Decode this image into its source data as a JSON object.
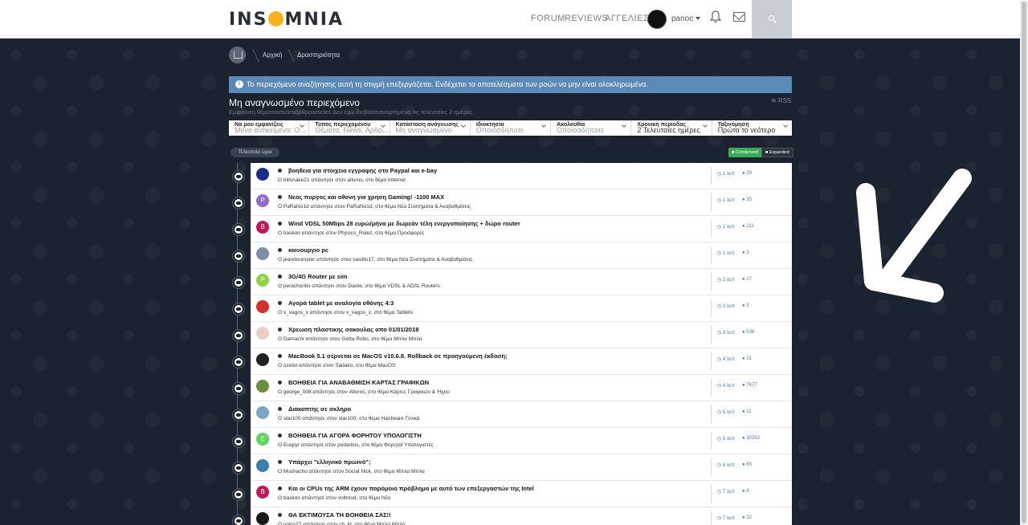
{
  "header": {
    "logo_text": "INSOMNIA",
    "nav": [
      "FORUM",
      "REVIEWS",
      "ΑΓΓΕΛΙΕΣ"
    ],
    "username": "panoc"
  },
  "breadcrumb": [
    "Αρχική",
    "Δραστηριότητα"
  ],
  "info_message": "Το περιεχόμενο αναζήτησης αυτή τη στιγμή επεξεργάζεται. Ενδέχεται τα αποτελέσματα των ροών να μην είναι ολοκληρωμένα.",
  "page_title": "Μη αναγνωσμένο περιεχόμενο",
  "rss_label": "RSS",
  "subtitle": "Εμφάνιση θέματαarticlesάρθραarticles Δεν έχω διαβάσειαναρτημένα τις τελευταίες 2 ημέρες.",
  "filters": [
    {
      "label": "Να μου εμφανίζεις",
      "value": "Μόνο αντικείμενα: Ο..."
    },
    {
      "label": "Τύπος περιεχομένου",
      "value": "Θέματα, News, Άρθρ..."
    },
    {
      "label": "Κατάσταση ανάγνωσης",
      "value": "Μη αναγνωσμένο"
    },
    {
      "label": "Ιδιοκτησία",
      "value": "Οποιοσδήποτε"
    },
    {
      "label": "Ακολουθία",
      "value": "Οποιοσδήποτε"
    },
    {
      "label": "Χρονική περίοδος",
      "value": "2 Τελευταίες ημέρες"
    },
    {
      "label": "Ταξινόμηση",
      "value": "Πρώτα το νεότερο"
    }
  ],
  "time_group": "Τελευταία ώρα",
  "view_toggle": {
    "condensed": "Condensed",
    "expanded": "Expanded"
  },
  "activity": [
    {
      "title": "βοηθεια για στοιχεια εγγραφης στο Paypal και e-bay",
      "meta": "O billsnake21 απάντησε στον alluros, στο θέμα Internet",
      "time": "1 λεπ",
      "replies": "29",
      "avatar": {
        "letter": "",
        "color": "#1b2f8a"
      }
    },
    {
      "title": "Νεος πυργος και οθονη για χρηση Gaming! -1100 MAX",
      "meta": "O PaRaNo1d απάντησε στον PaRaNo1d, στο θέμα Νέα Συστήματα & Αναβαθμίσεις",
      "time": "1 λεπ",
      "replies": "35",
      "avatar": {
        "letter": "P",
        "color": "#8e6bc9"
      }
    },
    {
      "title": "Wind VDSL 50Mbps 28 ευρώ/μήνα με δωρεάν τέλη ενεργοποίησης + δώρο router",
      "meta": "O baskon απάντησε στον Physics_Rulez, στο θέμα Προσφορές",
      "time": "1 λεπ",
      "replies": "211",
      "avatar": {
        "letter": "B",
        "color": "#c2185b"
      }
    },
    {
      "title": "καινουργιο pc",
      "meta": "O jeandoumpier απάντησε στον vasillis17, στο θέμα Νέα Συστήματα & Αναβαθμίσεις",
      "time": "1 λεπ",
      "replies": "3",
      "avatar": {
        "letter": "",
        "color": "#7d8fa8"
      }
    },
    {
      "title": "3G/4G Router με sim",
      "meta": "O perachoritis απάντησε στον Dante, στο θέμα VDSL & ADSL Routers",
      "time": "2 λεπ",
      "replies": "17",
      "avatar": {
        "letter": "P",
        "color": "#8bd44a"
      }
    },
    {
      "title": "Αγορά tablet με αναλογία οθόνης 4:3",
      "meta": "O x_vagos_x απάντησε στον x_vagos_x, στο θέμα Tablets",
      "time": "3 λεπ",
      "replies": "3",
      "avatar": {
        "letter": "",
        "color": "#d32f2f"
      }
    },
    {
      "title": "Χρεωση πλαστικης σακουλας απο 01/01/2018",
      "meta": "O Damachi απάντησε στον Getta Robo, στο θέμα Μπλα Μπλα",
      "time": "3 λεπ",
      "replies": "536",
      "avatar": {
        "letter": "",
        "color": "#e8cfc4"
      }
    },
    {
      "title": "MacBook 5.1 σέρνεται σε MacOS v10.6.8. Rollback σε προηγούμενη έκδοση;",
      "meta": "O ozelot απάντησε στον Sadako, στο θέμα MacOS",
      "time": "4 λεπ",
      "replies": "21",
      "avatar": {
        "letter": "",
        "color": "#222222"
      }
    },
    {
      "title": "ΒΟΗΘΕΙΑ ΓΙΑ ΑΝΑΒΑΘΜΙΣΗ ΚΑΡΤΑΣ ΓΡΑΦΙΚΩΝ",
      "meta": "O george_008 απάντησε στον Alluros, στο θέμα Κάρτες Γραφικών & Ήχου",
      "time": "4 λεπ",
      "replies": "7677",
      "avatar": {
        "letter": "",
        "color": "#6a8f3a"
      }
    },
    {
      "title": "Διακοπτης σε σκληρο",
      "meta": "O star100 απάντησε στον star100, στο θέμα Hardware Γενικά",
      "time": "5 λεπ",
      "replies": "11",
      "avatar": {
        "letter": "",
        "color": "#7aa7c7"
      }
    },
    {
      "title": "ΒΟΗΘΕΙΑ ΓΙΑ ΑΓΟΡΑ ΦΟΡΗΤΟΥ ΥΠΟΛΟΓΙΣΤΗ",
      "meta": "O Euspyr απάντησε στον podarilos, στο θέμα Φορητοί Υπολογιστές",
      "time": "5 λεπ",
      "replies": "30783",
      "avatar": {
        "letter": "E",
        "color": "#5cd65c"
      }
    },
    {
      "title": "Υπάρχει \"ελληνικό πρωινό\";",
      "meta": "O Muchacho απάντησε στον Social Nick, στο θέμα Μπλα Μπλα",
      "time": "6 λεπ",
      "replies": "63",
      "avatar": {
        "letter": "",
        "color": "#3a7fb0"
      }
    },
    {
      "title": "Και οι CPUs της ARM έχουν παρόμοιο πρόβλημα με αυτό των επεξεργαστών της Intel",
      "meta": "O baskon απάντησε στον voltmod, στο θέμα Νέα",
      "time": "7 λεπ",
      "replies": "4",
      "avatar": {
        "letter": "B",
        "color": "#c2185b"
      }
    },
    {
      "title": "ΘΑ ΕΚΤΙΜΟΥΣΑ ΤΗ ΒΟΗΘΕΙΑ ΣΑΣ!!",
      "meta": "O volos27 απάντησε στον ch_kt, στο θέμα Μπλα Μπλα",
      "time": "7 λεπ",
      "replies": "12",
      "avatar": {
        "letter": "",
        "color": "#1a1a1a"
      }
    }
  ]
}
